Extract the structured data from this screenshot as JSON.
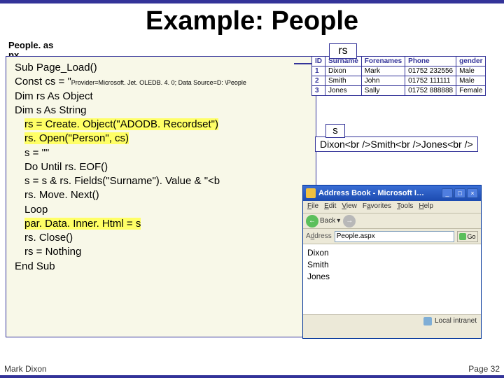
{
  "title": "Example: People",
  "file_label": "People. as px",
  "code": {
    "l1": "Sub Page_Load()",
    "l2a": "Const cs = \"",
    "l2b": "Provider=Microsoft. Jet. OLEDB. 4. 0; Data Source=D: \\People",
    "l3": "Dim rs As Object",
    "l4": "Dim s As String",
    "l5": "rs = Create. Object(\"ADODB. Recordset\")",
    "l6": "rs. Open(\"Person\", cs)",
    "l7": "s = \"\"",
    "l8": "Do Until rs. EOF()",
    "l9": "s = s & rs. Fields(\"Surname\"). Value & \"<b",
    "l10": "rs. Move. Next()",
    "l11": "Loop",
    "l12": "par. Data. Inner. Html = s",
    "l13": "rs. Close()",
    "l14": "rs = Nothing",
    "l15": "End Sub"
  },
  "rs_label": "rs",
  "db": {
    "headers": {
      "id": "ID",
      "surname": "Surname",
      "forenames": "Forenames",
      "phone": "Phone",
      "gender": "gender"
    },
    "rows": [
      {
        "id": "1",
        "surname": "Dixon",
        "forenames": "Mark",
        "phone": "01752 232556",
        "gender": "Male"
      },
      {
        "id": "2",
        "surname": "Smith",
        "forenames": "John",
        "phone": "01752 111111",
        "gender": "Male"
      },
      {
        "id": "3",
        "surname": "Jones",
        "forenames": "Sally",
        "phone": "01752 888888",
        "gender": "Female"
      }
    ]
  },
  "s_label": "s",
  "s_content": "Dixon<br />Smith<br />Jones<br />",
  "browser": {
    "title": "Address Book - Microsoft I…",
    "menu": {
      "file": "File",
      "edit": "Edit",
      "view": "View",
      "favorites": "Favorites",
      "tools": "Tools",
      "help": "Help"
    },
    "back": "Back",
    "addr_label": "Address",
    "addr_value": "People.aspx",
    "go": "Go",
    "body": {
      "l1": "Dixon",
      "l2": "Smith",
      "l3": "Jones"
    },
    "status": "Local intranet",
    "btn_min": "_",
    "btn_max": "□",
    "btn_close": "×"
  },
  "footer": {
    "left": "Mark Dixon",
    "right": "Page 32"
  }
}
